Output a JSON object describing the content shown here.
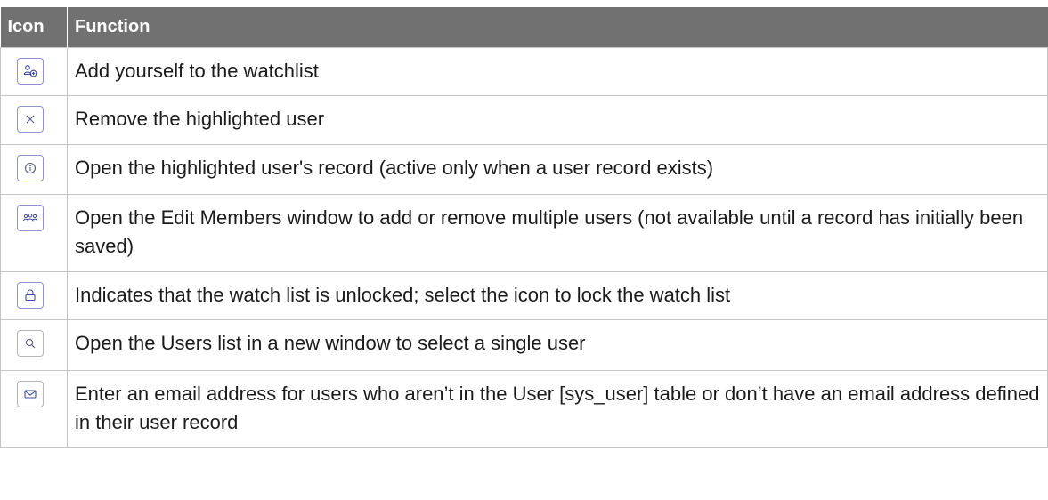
{
  "table": {
    "headers": {
      "icon": "Icon",
      "function": "Function"
    },
    "rows": [
      {
        "icon": "add-me-icon",
        "function": "Add yourself to the watchlist"
      },
      {
        "icon": "close-icon",
        "function": "Remove the highlighted user"
      },
      {
        "icon": "info-icon",
        "function": "Open the highlighted user's record (active only when a user record exists)"
      },
      {
        "icon": "group-icon",
        "function": "Open the Edit Members window to add or remove multiple users (not available until a record has initially been saved)"
      },
      {
        "icon": "unlock-icon",
        "function": "Indicates that the watch list is unlocked; select the icon to lock the watch list"
      },
      {
        "icon": "search-icon",
        "function": "Open the Users list in a new window to select a single user"
      },
      {
        "icon": "email-icon",
        "function": "Enter an email address for users who aren’t in the User [sys_user] table or don’t have an email address defined in their user record"
      }
    ]
  },
  "colors": {
    "header_bg": "#717171",
    "icon_border": "#8f95c9",
    "icon_glyph": "#3d4a9c"
  }
}
